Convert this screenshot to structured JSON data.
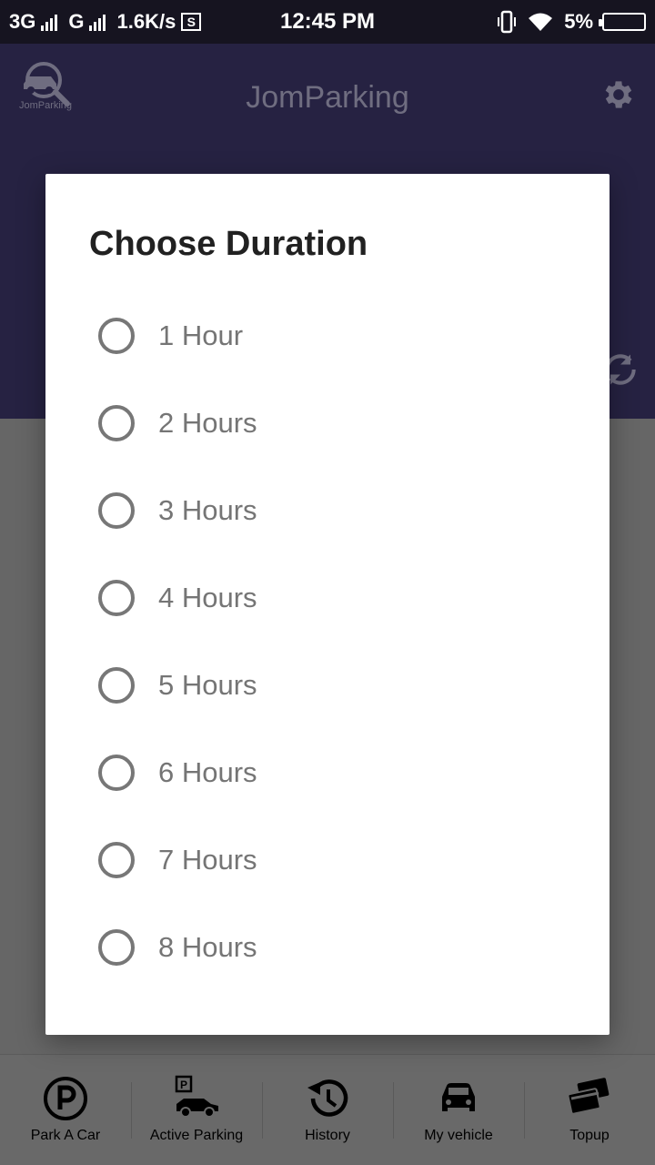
{
  "status_bar": {
    "network1": "3G",
    "network2": "G",
    "speed": "1.6K/s",
    "sim_icon": "S",
    "time": "12:45 PM",
    "battery": "5%"
  },
  "app_bar": {
    "title": "JomParking",
    "logo_caption": "JomParking"
  },
  "dialog": {
    "title": "Choose Duration",
    "options": [
      "1 Hour",
      "2 Hours",
      "3 Hours",
      "4 Hours",
      "5 Hours",
      "6 Hours",
      "7 Hours",
      "8 Hours"
    ]
  },
  "bottom_nav": {
    "items": [
      {
        "label": "Park A Car",
        "icon": "parking-icon"
      },
      {
        "label": "Active Parking",
        "icon": "active-parking-icon"
      },
      {
        "label": "History",
        "icon": "history-icon"
      },
      {
        "label": "My vehicle",
        "icon": "car-icon"
      },
      {
        "label": "Topup",
        "icon": "cards-icon"
      }
    ]
  },
  "colors": {
    "app_bar": "#262242",
    "status_bar": "#161420",
    "dim_overlay": "#666666",
    "radio": "#777777"
  }
}
